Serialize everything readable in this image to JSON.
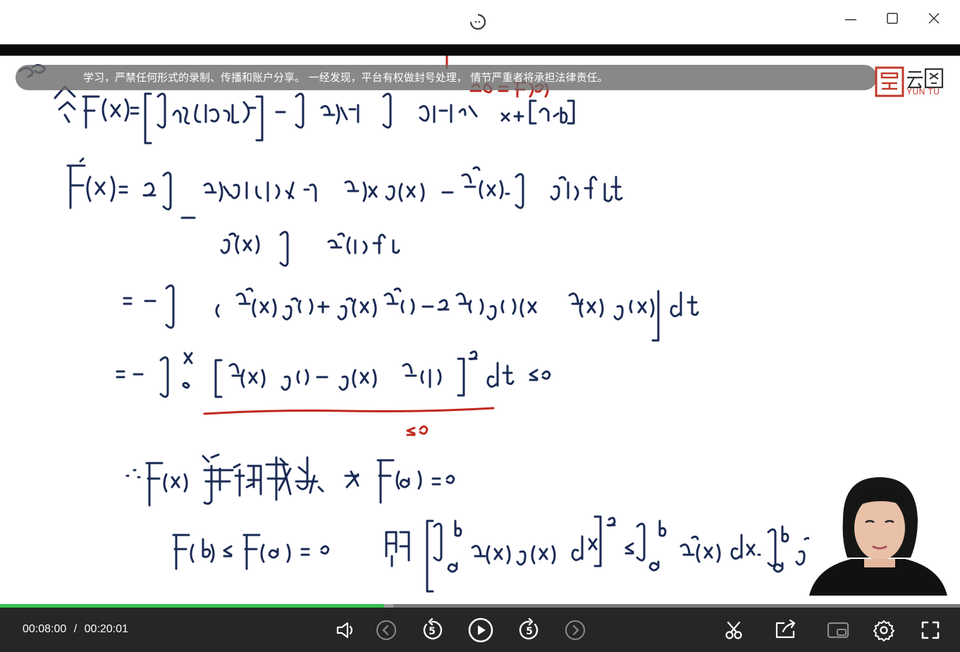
{
  "window": {
    "logo_icon": "app-logo-icon",
    "minimize_icon": "minimize-icon",
    "maximize_icon": "maximize-icon",
    "close_icon": "close-icon"
  },
  "player": {
    "notice_text": "学习，严禁任何形式的录制、传播和账户分享。 一经发现，平台有权做封号处理， 情节严重者将承担法律责任。",
    "brand_text": "YUN TU",
    "brand_icon": "yuntu-logo-icon",
    "current_time": "00:08:00",
    "time_separator": "/",
    "total_time": "00:20:01",
    "progress": 0.4,
    "buffered": 0.41,
    "accent_color": "#31c24d"
  },
  "controls": {
    "volume_icon": "volume-icon",
    "previous_icon": "previous-icon",
    "rewind_icon": "rewind-5-icon",
    "rewind_label": "5",
    "play_icon": "play-icon",
    "forward_icon": "forward-5-icon",
    "forward_label": "5",
    "next_icon": "next-icon",
    "clip_icon": "scissors-icon",
    "share_icon": "share-icon",
    "pip_icon": "picture-in-picture-icon",
    "settings_icon": "gear-icon",
    "fullscreen_icon": "fullscreen-icon"
  }
}
